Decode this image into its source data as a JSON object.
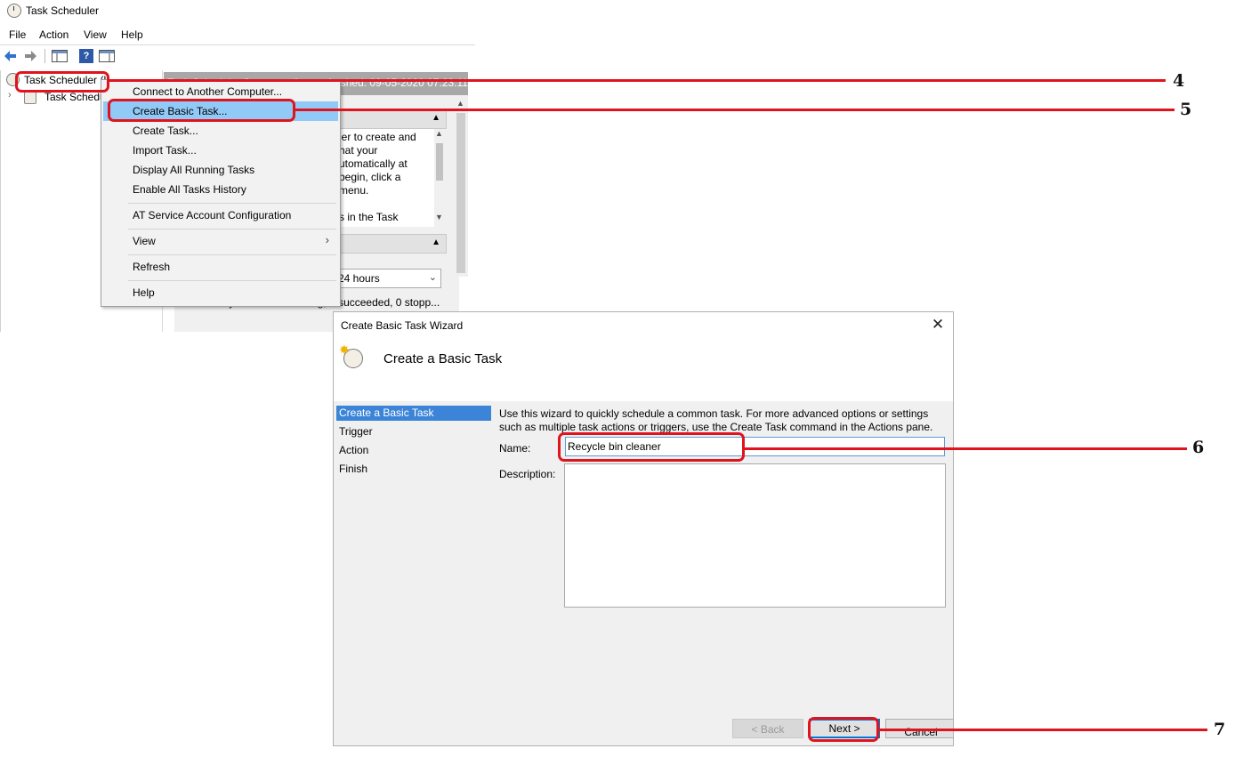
{
  "task_scheduler": {
    "title": "Task Scheduler",
    "menu": [
      "File",
      "Action",
      "View",
      "Help"
    ],
    "tree": {
      "root_label": "Task Scheduler (L",
      "child_label": "Task Schedul"
    },
    "main": {
      "summary_header": "Task Scheduler Summary (Last refreshed: 09-05-2020 07:23:11)",
      "overview_lines": [
        "ler to create and",
        "hat your",
        "utomatically at",
        "begin, click a",
        "menu.",
        "s in the Task"
      ],
      "period_value": "24 hours",
      "summary_status": "Summary: 0 total - 0 running, 0 succeeded, 0 stopp..."
    }
  },
  "context_menu": {
    "items": [
      "Connect to Another Computer...",
      "Create Basic Task...",
      "Create Task...",
      "Import Task...",
      "Display All Running Tasks",
      "Enable All Tasks History",
      "AT Service Account Configuration",
      "View",
      "Refresh",
      "Help"
    ],
    "highlighted": "Create Basic Task..."
  },
  "wizard": {
    "window_title": "Create Basic Task Wizard",
    "close_glyph": "✕",
    "heading": "Create a Basic Task",
    "steps": [
      "Create a Basic Task",
      "Trigger",
      "Action",
      "Finish"
    ],
    "active_step": "Create a Basic Task",
    "intro_line1": "Use this wizard to quickly schedule a common task.  For more advanced options or settings",
    "intro_line2": "such as multiple task actions or triggers, use the Create Task command in the Actions pane.",
    "name_label": "Name:",
    "name_value": "Recycle bin cleaner",
    "description_label": "Description:",
    "buttons": {
      "back": "< Back",
      "next": "Next >",
      "cancel": "Cancel"
    }
  },
  "annotations": [
    "4",
    "5",
    "6",
    "7"
  ],
  "colors": {
    "annotation": "#e0141e",
    "menu_highlight": "#91c9f7",
    "nav_active": "#3c84d8",
    "input_border": "#5b9bd5"
  }
}
